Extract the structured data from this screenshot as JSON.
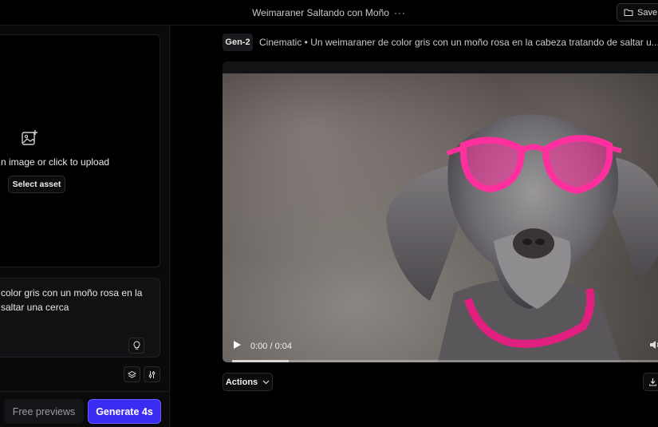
{
  "header": {
    "title": "Weimaraner Saltando con Moño",
    "more_label": "···",
    "save_label": "Save i"
  },
  "left": {
    "upload_text": "n image or click to upload",
    "select_asset_label": "Select asset",
    "prompt_line1": "color gris con un moño rosa en la",
    "prompt_line2": "saltar una cerca",
    "free_previews_label": "Free previews",
    "generate_label": "Generate 4s"
  },
  "main": {
    "model_badge": "Gen-2",
    "description": "Cinematic • Un weimaraner de color gris con un moño rosa en la cabeza tratando de saltar u...",
    "video": {
      "time": "0:00 / 0:04",
      "progress": 0.13
    },
    "actions_label": "Actions"
  },
  "colors": {
    "accent": "#3b2cf4",
    "glasses": "#ff2f9e",
    "background": "#000000"
  }
}
